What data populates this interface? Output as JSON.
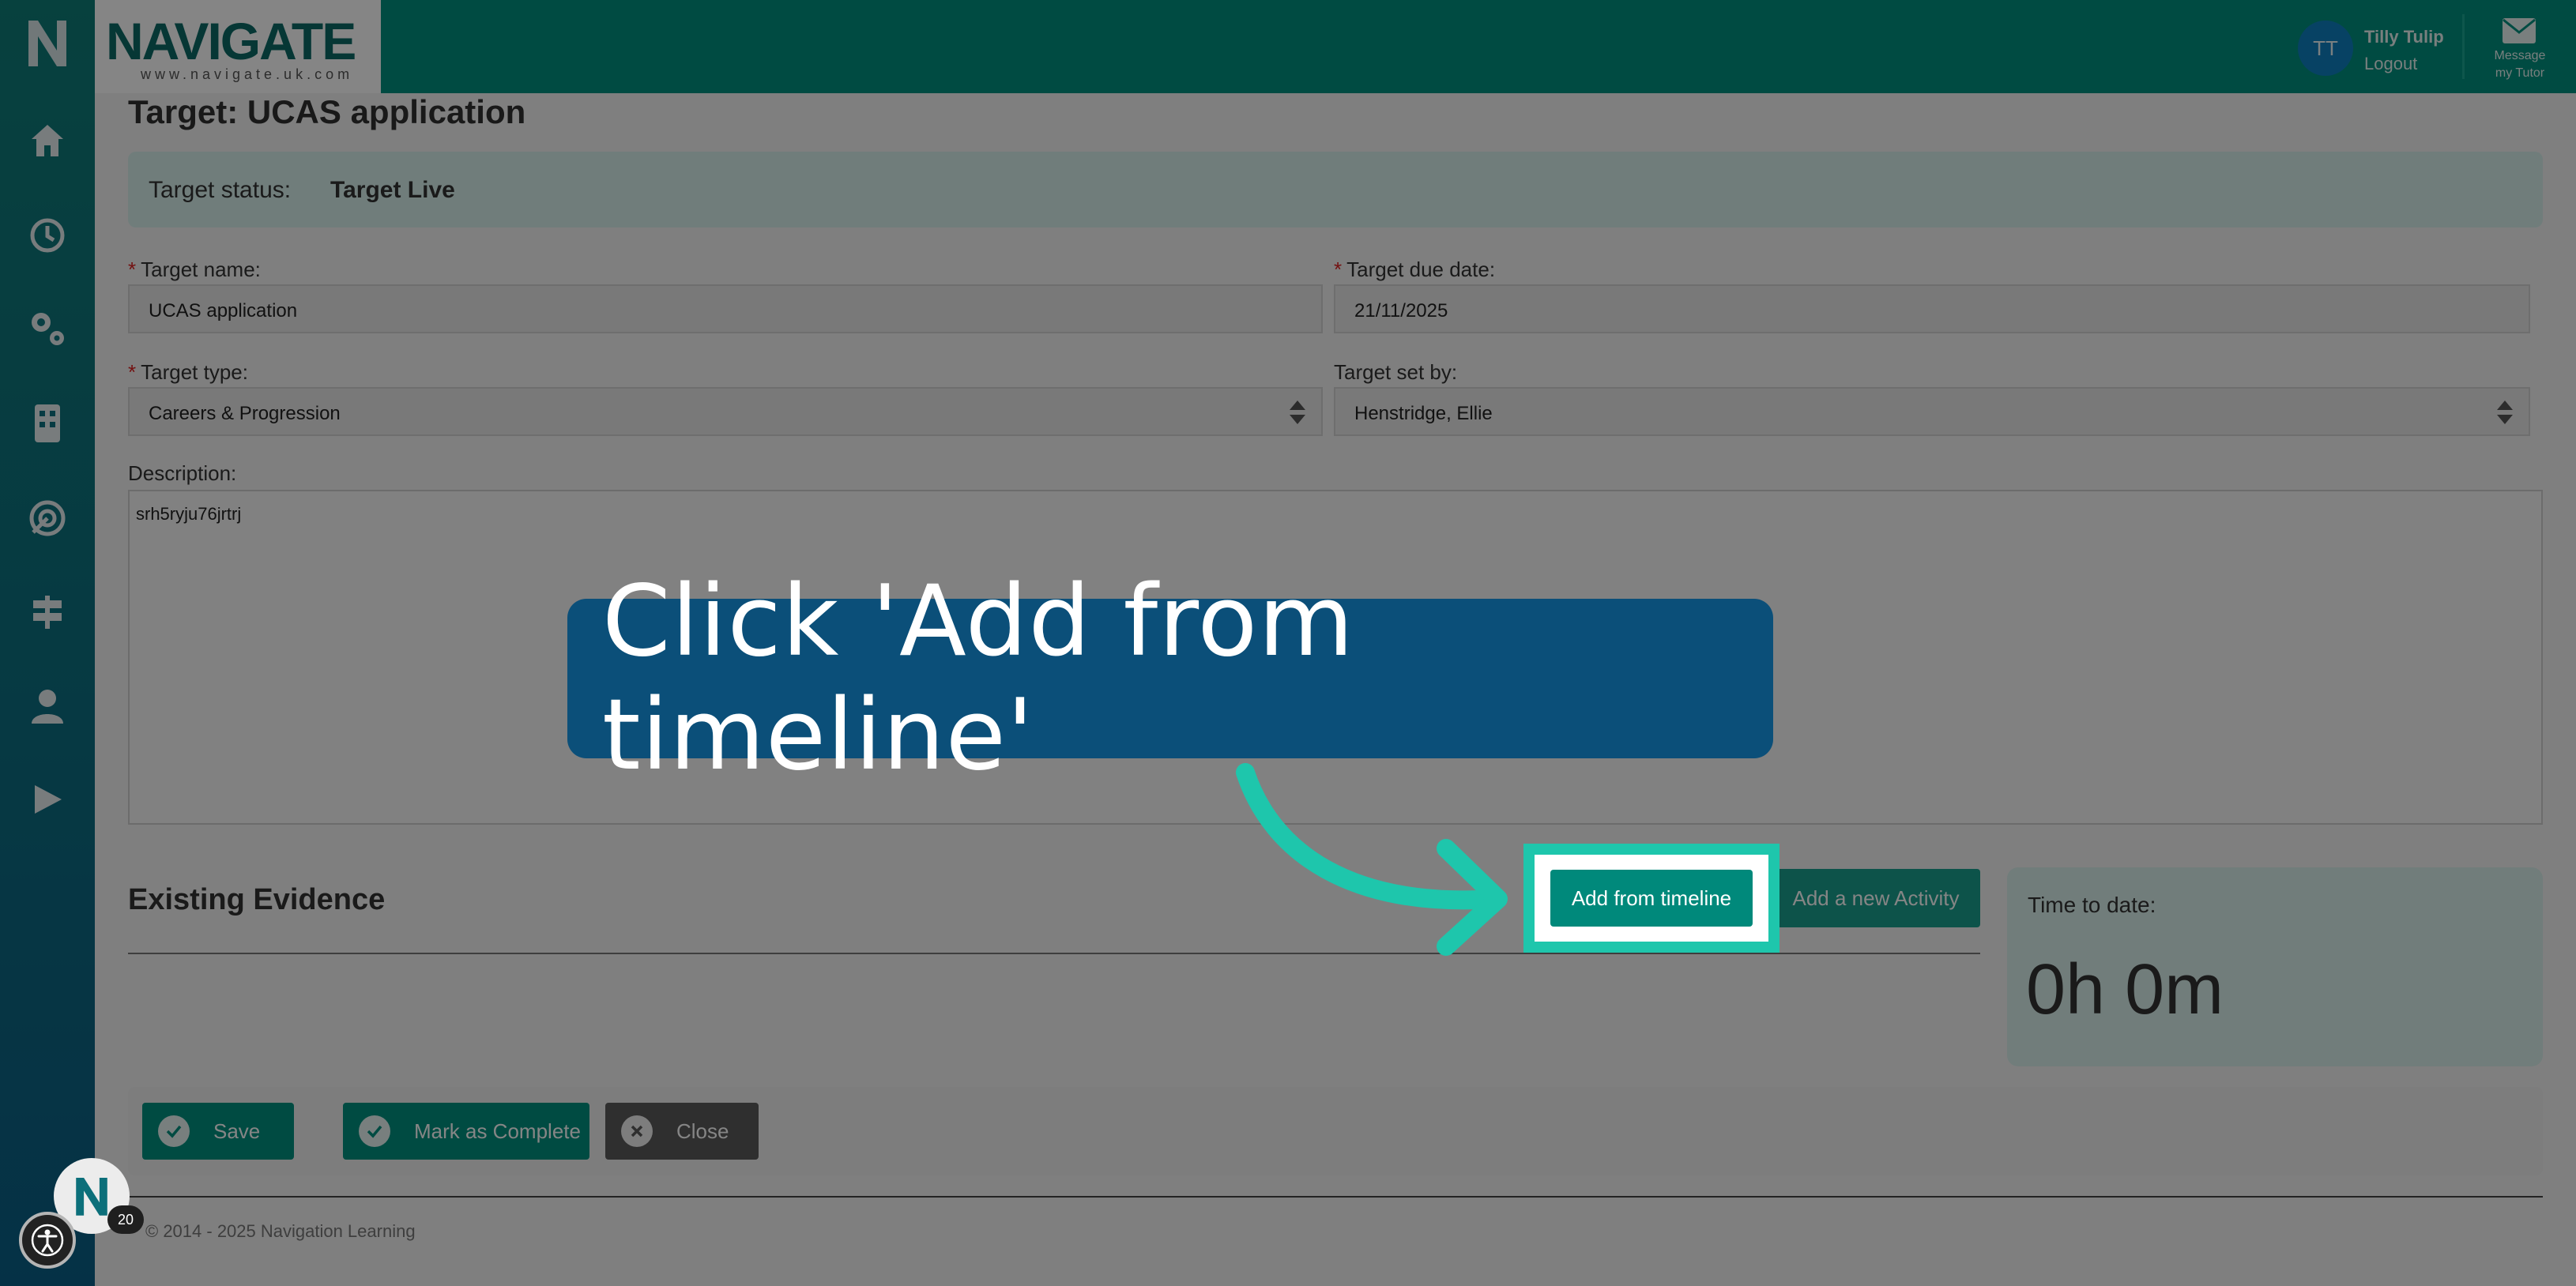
{
  "header": {
    "brand_name": "NAVIGATE",
    "brand_url": "www.navigate.uk.com",
    "user_initials": "TT",
    "user_name": "Tilly Tulip",
    "logout_label": "Logout",
    "message_label_line1": "Message",
    "message_label_line2": "my Tutor"
  },
  "sidebar": {
    "logo_letter": "N",
    "items": [
      {
        "icon": "home-icon"
      },
      {
        "icon": "clock-icon"
      },
      {
        "icon": "gears-icon"
      },
      {
        "icon": "building-icon"
      },
      {
        "icon": "target-icon"
      },
      {
        "icon": "signpost-icon"
      },
      {
        "icon": "user-icon"
      },
      {
        "icon": "play-icon"
      }
    ]
  },
  "page": {
    "title": "Target: UCAS application",
    "status_label": "Target status:",
    "status_value": "Target Live"
  },
  "form": {
    "required_mark": "*",
    "target_name_label": "Target name:",
    "target_name_value": "UCAS application",
    "due_date_label": "Target due date:",
    "due_date_value": "21/11/2025",
    "type_label": "Target type:",
    "type_value": "Careers & Progression",
    "set_by_label": "Target set by:",
    "set_by_value": "Henstridge, Ellie",
    "description_label": "Description:",
    "description_value": "srh5ryju76jrtrj"
  },
  "evidence": {
    "title": "Existing Evidence",
    "add_from_timeline_label": "Add from timeline",
    "add_activity_label": "Add a new Activity"
  },
  "time": {
    "label": "Time to date:",
    "value": "0h 0m"
  },
  "actions": {
    "save_label": "Save",
    "complete_label": "Mark as Complete",
    "close_label": "Close"
  },
  "footer": {
    "copyright": "© 2014 - 2025 Navigation Learning"
  },
  "overlay": {
    "instruction": "Click 'Add from timeline'",
    "accent_color": "#1ec6ac",
    "callout_color": "#0b4f79"
  },
  "widgets": {
    "bubble_letter": "N",
    "notification_count": "20"
  }
}
